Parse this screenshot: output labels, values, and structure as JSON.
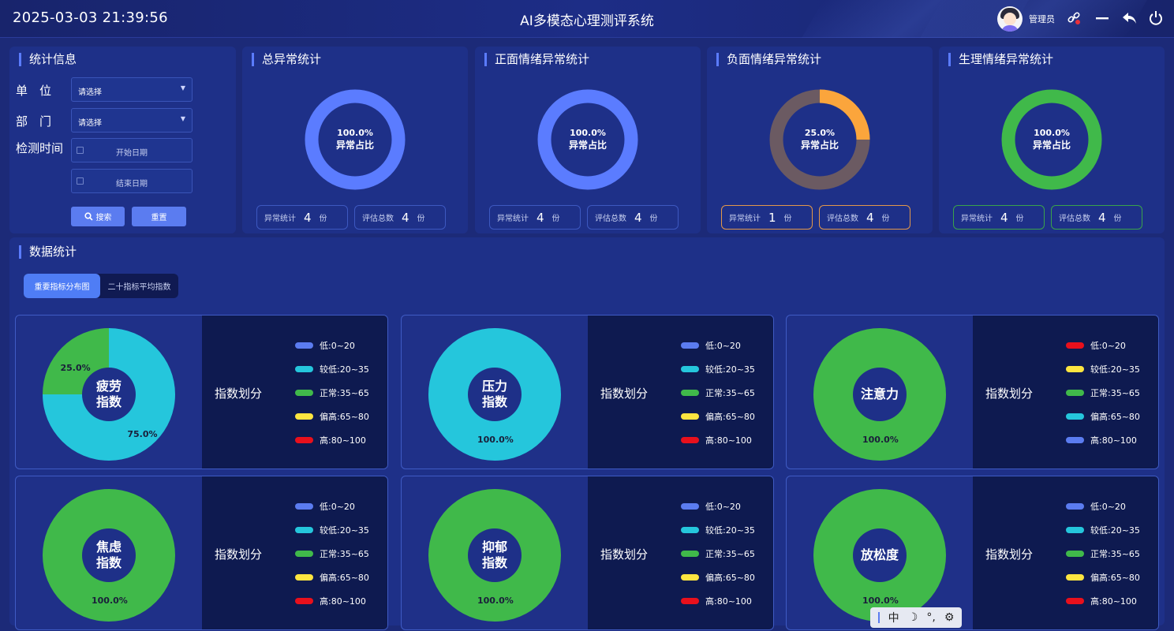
{
  "header": {
    "datetime": "2025-03-03 21:39:56",
    "title": "AI多模态心理测评系统",
    "user": {
      "name": "管理员",
      "avatar_icon": "user-avatar"
    },
    "icons": [
      "link-icon",
      "minimize-icon",
      "back-icon",
      "power-icon"
    ]
  },
  "filter": {
    "title": "统计信息",
    "unit_label": "单　位",
    "unit_value": "请选择",
    "dept_label": "部　门",
    "dept_value": "请选择",
    "time_label": "检测时间",
    "start_placeholder": "开始日期",
    "end_placeholder": "结束日期",
    "search_label": "搜索",
    "reset_label": "重置"
  },
  "stats": [
    {
      "title": "总异常统计",
      "percent": "100.0%",
      "center_label": "异常占比",
      "fraction": 1.0,
      "ring_color": "#5b7cff",
      "rest_color": "#5b7cff",
      "border_color": "#3d58c0",
      "abnormal_label": "异常统计",
      "abnormal_count": "4",
      "total_label": "评估总数",
      "total_count": "4",
      "unit": "份"
    },
    {
      "title": "正面情绪异常统计",
      "percent": "100.0%",
      "center_label": "异常占比",
      "fraction": 1.0,
      "ring_color": "#5b7cff",
      "rest_color": "#5b7cff",
      "border_color": "#3d58c0",
      "abnormal_label": "异常统计",
      "abnormal_count": "4",
      "total_label": "评估总数",
      "total_count": "4",
      "unit": "份"
    },
    {
      "title": "负面情绪异常统计",
      "percent": "25.0%",
      "center_label": "异常占比",
      "fraction": 0.25,
      "ring_color": "#fba53c",
      "rest_color": "#6b5a62",
      "border_color": "#e3984a",
      "abnormal_label": "异常统计",
      "abnormal_count": "1",
      "total_label": "评估总数",
      "total_count": "4",
      "unit": "份"
    },
    {
      "title": "生理情绪异常统计",
      "percent": "100.0%",
      "center_label": "异常占比",
      "fraction": 1.0,
      "ring_color": "#40b94a",
      "rest_color": "#40b94a",
      "border_color": "#3aa34a",
      "abnormal_label": "异常统计",
      "abnormal_count": "4",
      "total_label": "评估总数",
      "total_count": "4",
      "unit": "份"
    }
  ],
  "data_section": {
    "title": "数据统计",
    "tabs": [
      {
        "label": "重要指标分布图",
        "active": true
      },
      {
        "label": "二十指标平均指数",
        "active": false
      }
    ]
  },
  "legend_title": "指数划分",
  "legend_default": [
    {
      "label": "低:0~20",
      "color": "#5b7cf0"
    },
    {
      "label": "较低:20~35",
      "color": "#25c6dc"
    },
    {
      "label": "正常:35~65",
      "color": "#40b94a"
    },
    {
      "label": "偏高:65~80",
      "color": "#fde540"
    },
    {
      "label": "高:80~100",
      "color": "#e8101c"
    }
  ],
  "legend_reversed": [
    {
      "label": "低:0~20",
      "color": "#e8101c"
    },
    {
      "label": "较低:20~35",
      "color": "#fde540"
    },
    {
      "label": "正常:35~65",
      "color": "#40b94a"
    },
    {
      "label": "偏高:65~80",
      "color": "#25c6dc"
    },
    {
      "label": "高:80~100",
      "color": "#5b7cf0"
    }
  ],
  "chart_data": [
    {
      "type": "pie",
      "title": "疲劳指数",
      "center": [
        "疲劳",
        "指数"
      ],
      "legend": "default",
      "slices": [
        {
          "label": "25.0%",
          "value": 25.0,
          "color": "#40b94a"
        },
        {
          "label": "75.0%",
          "value": 75.0,
          "color": "#25c6dc"
        }
      ]
    },
    {
      "type": "pie",
      "title": "压力指数",
      "center": [
        "压力",
        "指数"
      ],
      "legend": "default",
      "slices": [
        {
          "label": "100.0%",
          "value": 100.0,
          "color": "#25c6dc"
        }
      ]
    },
    {
      "type": "pie",
      "title": "注意力",
      "center": [
        "注意力"
      ],
      "legend": "reversed",
      "slices": [
        {
          "label": "100.0%",
          "value": 100.0,
          "color": "#40b94a"
        }
      ]
    },
    {
      "type": "pie",
      "title": "焦虑指数",
      "center": [
        "焦虑",
        "指数"
      ],
      "legend": "default",
      "slices": [
        {
          "label": "100.0%",
          "value": 100.0,
          "color": "#40b94a"
        }
      ]
    },
    {
      "type": "pie",
      "title": "抑郁指数",
      "center": [
        "抑郁",
        "指数"
      ],
      "legend": "default",
      "slices": [
        {
          "label": "100.0%",
          "value": 100.0,
          "color": "#40b94a"
        }
      ]
    },
    {
      "type": "pie",
      "title": "放松度",
      "center": [
        "放松度"
      ],
      "legend": "default",
      "slices": [
        {
          "label": "100.0%",
          "value": 100.0,
          "color": "#40b94a"
        }
      ]
    }
  ],
  "ime": {
    "items": [
      "中",
      "☽",
      "°,",
      "⚙"
    ]
  }
}
